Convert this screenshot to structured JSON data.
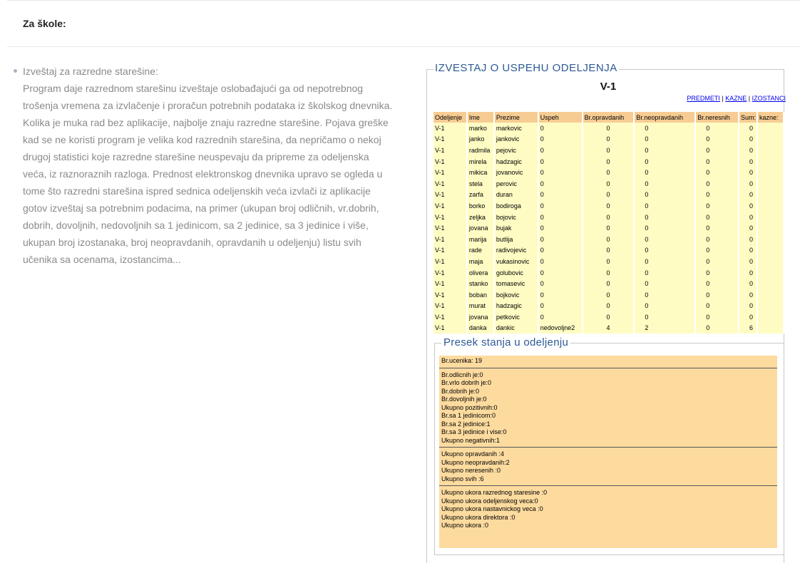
{
  "section": {
    "heading": "Za škole:"
  },
  "item": {
    "title": "Izveštaj za razredne starešine:",
    "lines": [
      "Program daje razrednom starešinu izveštaje oslobađajući ga od nepotrebnog",
      "trošenja vremena za izvlačenje i proračun potrebnih podataka iz školskog dnevnika.",
      "Kolika je muka rad bez aplikacije, najbolje znaju razredne starešine. Pojava greške",
      "kad se ne koristi program je velika kod razrednih starešina, da nepričamo o nekoj",
      "drugoj statistici koje razredne starešine neuspevaju da pripreme za odeljenska",
      "veća, iz raznoraznih razloga. Prednost elektronskog dnevnika upravo se ogleda u",
      "tome što razredni starešina ispred sednica odeljenskih veća izvlači iz aplikacije",
      "gotov izveštaj sa potrebnim podacima, na primer (ukupan broj odličnih, vr.dobrih,",
      "dobrih, dovoljnih, nedovoljnih sa 1 jedinicom, sa 2 jedinice, sa 3 jedinice i više,",
      "ukupan broj izostanaka, broj neopravdanih, opravdanih u odeljenju) listu svih",
      "učenika sa ocenama, izostancima..."
    ]
  },
  "report": {
    "legend": "IZVESTAJ O USPEHU ODELJENJA",
    "class_title": "V-1",
    "links": {
      "predmeti": "PREDMETI",
      "kazne": "KAZNE",
      "izostanci": "IZOSTANCI",
      "sep": "|"
    },
    "columns": [
      "Odeljenje",
      "Ime",
      "Prezime",
      "Uspeh",
      "Br.opravdanih",
      "Br.neopravdanih",
      "Br.neresnih",
      "Sum:",
      "kazne:"
    ],
    "rows": [
      [
        "V-1",
        "marko",
        "markovic",
        "0",
        "0",
        "0",
        "0",
        "0",
        ""
      ],
      [
        "V-1",
        "janko",
        "jankovic",
        "0",
        "0",
        "0",
        "0",
        "0",
        ""
      ],
      [
        "V-1",
        "radmila",
        "pejovic",
        "0",
        "0",
        "0",
        "0",
        "0",
        ""
      ],
      [
        "V-1",
        "mirela",
        "hadzagic",
        "0",
        "0",
        "0",
        "0",
        "0",
        ""
      ],
      [
        "V-1",
        "mikica",
        "jovanovic",
        "0",
        "0",
        "0",
        "0",
        "0",
        ""
      ],
      [
        "V-1",
        "stela",
        "perovic",
        "0",
        "0",
        "0",
        "0",
        "0",
        ""
      ],
      [
        "V-1",
        "zarfa",
        "duran",
        "0",
        "0",
        "0",
        "0",
        "0",
        ""
      ],
      [
        "V-1",
        "borko",
        "bodiroga",
        "0",
        "0",
        "0",
        "0",
        "0",
        ""
      ],
      [
        "V-1",
        "zeljka",
        "bojovic",
        "0",
        "0",
        "0",
        "0",
        "0",
        ""
      ],
      [
        "V-1",
        "jovana",
        "bujak",
        "0",
        "0",
        "0",
        "0",
        "0",
        ""
      ],
      [
        "V-1",
        "marija",
        "butlija",
        "0",
        "0",
        "0",
        "0",
        "0",
        ""
      ],
      [
        "V-1",
        "rade",
        "radivojevic",
        "0",
        "0",
        "0",
        "0",
        "0",
        ""
      ],
      [
        "V-1",
        "maja",
        "vukasinovic",
        "0",
        "0",
        "0",
        "0",
        "0",
        ""
      ],
      [
        "V-1",
        "olivera",
        "golubovic",
        "0",
        "0",
        "0",
        "0",
        "0",
        ""
      ],
      [
        "V-1",
        "stanko",
        "tomasevic",
        "0",
        "0",
        "0",
        "0",
        "0",
        ""
      ],
      [
        "V-1",
        "boban",
        "bojkovic",
        "0",
        "0",
        "0",
        "0",
        "0",
        ""
      ],
      [
        "V-1",
        "murat",
        "hadzagic",
        "0",
        "0",
        "0",
        "0",
        "0",
        ""
      ],
      [
        "V-1",
        "jovana",
        "petkovic",
        "0",
        "0",
        "0",
        "0",
        "0",
        ""
      ],
      [
        "V-1",
        "danka",
        "dankic",
        "nedovoljne2",
        "4",
        "2",
        "0",
        "6",
        ""
      ]
    ],
    "summary": {
      "legend": "Presek stanja u odeljenju",
      "groups": [
        [
          "Br.ucenika: 19"
        ],
        [
          "Br.odlicnih je:0",
          "Br.vrlo dobrih je:0",
          "Br.dobrih je:0",
          "Br.dovoljnih je:0",
          "Ukupno pozitivnih:0",
          "Br.sa 1 jedinicom:0",
          "Br.sa 2 jedinice:1",
          "Br.sa 3 jedinice i vise:0",
          "Ukupno negativnih:1"
        ],
        [
          "Ukupno opravdanih :4",
          "Ukupno neopravdanih:2",
          "Ukupno neresenih :0",
          "Ukupno svih :6"
        ],
        [
          "Ukupno ukora razrednog staresine :0",
          "Ukupno ukora odeljenskog veca:0",
          "Ukupno ukora nastavnickog veca :0",
          "Ukupno ukora direktora :0",
          "Ukupno ukora :0"
        ]
      ]
    }
  },
  "colors": {
    "legend_blue": "#2d5a95",
    "header_bg": "#f7cc93",
    "row_bg": "#fffcc3",
    "summary_bg": "#fddb9f",
    "body_text_gray": "#8a8a8a"
  }
}
